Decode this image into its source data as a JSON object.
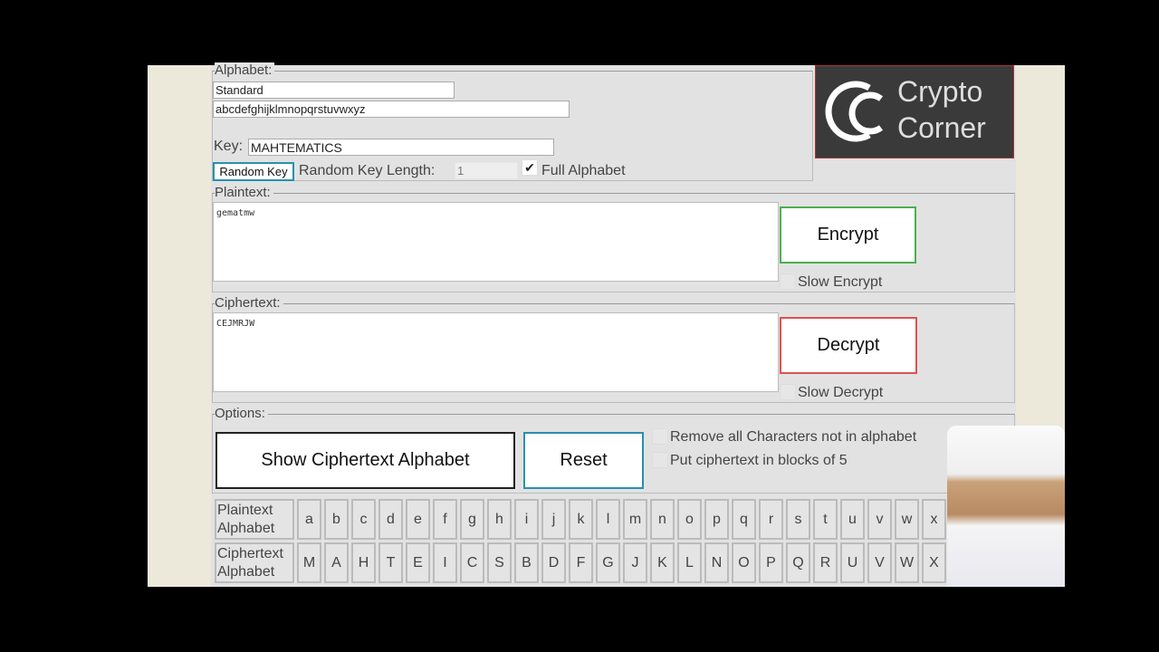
{
  "alphabet": {
    "legend": "Alphabet:",
    "preset": "Standard",
    "letters": "abcdefghijklmnopqrstuvwxyz",
    "key_label": "Key:",
    "key_value": "MAHTEMATICS",
    "random_key": "Random Key",
    "random_len_label": "Random Key Length:",
    "random_len_value": "1",
    "full_alphabet": "Full Alphabet"
  },
  "logo": {
    "line1": "Crypto",
    "line2": "Corner"
  },
  "plaintext": {
    "legend": "Plaintext:",
    "value": "gematmw",
    "encrypt": "Encrypt",
    "slow_encrypt": "Slow Encrypt"
  },
  "ciphertext": {
    "legend": "Ciphertext:",
    "value": "CEJMRJW",
    "decrypt": "Decrypt",
    "slow_decrypt": "Slow Decrypt"
  },
  "options": {
    "legend": "Options:",
    "show_alphabet": "Show Ciphertext Alphabet",
    "reset": "Reset",
    "remove_chars": "Remove all Characters not in alphabet",
    "blocks_of_5": "Put ciphertext in blocks of 5"
  },
  "table": {
    "plain_header": "Plaintext Alphabet",
    "cipher_header": "Ciphertext Alphabet",
    "plain": [
      "a",
      "b",
      "c",
      "d",
      "e",
      "f",
      "g",
      "h",
      "i",
      "j",
      "k",
      "l",
      "m",
      "n",
      "o",
      "p",
      "q",
      "r",
      "s",
      "t",
      "u",
      "v",
      "w",
      "x"
    ],
    "cipher": [
      "M",
      "A",
      "H",
      "T",
      "E",
      "I",
      "C",
      "S",
      "B",
      "D",
      "F",
      "G",
      "J",
      "K",
      "L",
      "N",
      "O",
      "P",
      "Q",
      "R",
      "U",
      "V",
      "W",
      "X"
    ]
  },
  "colors": {
    "encrypt_border": "#4caf50",
    "decrypt_border": "#e05050",
    "reset_border": "#2a8fb0"
  }
}
